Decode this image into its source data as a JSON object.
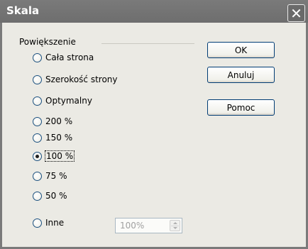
{
  "window": {
    "title": "Skala",
    "close_icon": "✕"
  },
  "group": {
    "label": "Powiększenie"
  },
  "options": [
    {
      "label": "Cała strona",
      "checked": false
    },
    {
      "label": "Szerokość strony",
      "checked": false
    },
    {
      "label": "Optymalny",
      "checked": false
    },
    {
      "label": "200 %",
      "checked": false
    },
    {
      "label": "150 %",
      "checked": false
    },
    {
      "label": "100 %",
      "checked": true
    },
    {
      "label": "75 %",
      "checked": false
    },
    {
      "label": "50 %",
      "checked": false
    },
    {
      "label": "Inne",
      "checked": false
    }
  ],
  "other_value": "100%",
  "buttons": {
    "ok": "OK",
    "cancel": "Anuluj",
    "help": "Pomoc"
  },
  "colors": {
    "titlebar": "#7a7a7a",
    "dialog_background": "#ebeae4",
    "button_border": "#003c74"
  }
}
